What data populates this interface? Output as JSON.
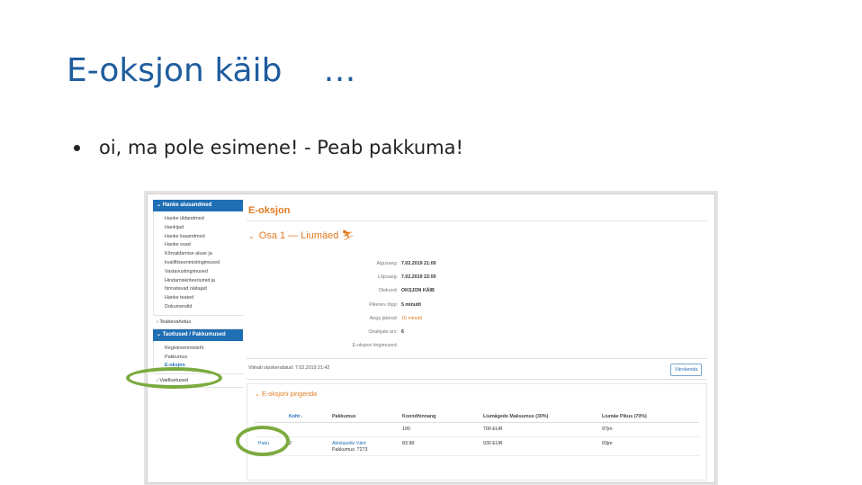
{
  "slide": {
    "title": "E-oksjon käib",
    "title_ellipsis": "…",
    "bullet": "oi, ma pole esimene! - Peab pakkuma!"
  },
  "sidebar": {
    "section1_header": "Hanke alusandmed",
    "section1_items": [
      "Hanke üldandmed",
      "Hankijad",
      "Hanke lisaandmed",
      "Hanke osad",
      "Kõrvaldamise aluse ja",
      "kvalifitseerimistingimused",
      "Vastavustingimused",
      "Hindamiskriteeriumid ja",
      "hinnatavad näitajad",
      "Hanke teated",
      "Dokumendid"
    ],
    "teabevahetus": "Teabevahetus",
    "section2_header": "Taotlused / Pakkumused",
    "section2_items": [
      "Registreerimisleht",
      "Pakkumus",
      "E-oksjon"
    ],
    "vaidlustused": "Vaidlustused"
  },
  "main": {
    "header": "E-oksjon",
    "osa_title": "Osa 1 — Liumäed",
    "osa_icon": "skier-icon",
    "info": [
      {
        "label": "Algusaeg:",
        "value": "7.02.2019 21:00",
        "highlight": false
      },
      {
        "label": "Lõpuaeg:",
        "value": "7.02.2019 22:00",
        "highlight": false
      },
      {
        "label": "Olekund:",
        "value": "OKSJON KÄIB",
        "highlight": false
      },
      {
        "label": "Pikenev lõpp:",
        "value": "5 minutit",
        "highlight": false
      },
      {
        "label": "Aega jäänud:",
        "value": "16 minutit",
        "highlight": true
      },
      {
        "label": "Osalejate arv:",
        "value": "6",
        "highlight": false
      },
      {
        "label": "E-oksjoni tingimused:",
        "value": "",
        "highlight": false
      }
    ],
    "updated_text": "Viimati värskendatud: 7.02.2019 21:42",
    "refresh_label": "Värskenda",
    "ranking_title": "E-oksjoni pingerida",
    "table_headers": [
      "",
      "Koht ↓",
      "Pakkumus",
      "Koondhinnang",
      "Liumägede Maksumus (30%)",
      "Liumäe Pikus (70%)"
    ],
    "table_rows": [
      {
        "c0": "",
        "c1": "",
        "c2a": "",
        "c2b": "",
        "c3": "100",
        "c4": "700 EUR",
        "c5": "97jm"
      },
      {
        "c0": "Paku",
        "c1": "2",
        "c2a": "Aktsiaselts Vänt",
        "c2b": "Pakkumus: 7273",
        "c3": "83.98",
        "c4": "930 EUR",
        "c5": "83jm"
      }
    ]
  },
  "colors": {
    "title_blue": "#1f5d9e",
    "sidebar_blue": "#1f6fb4",
    "accent_orange": "#e07b22",
    "highlight_ring_green": "#7bab3f"
  }
}
